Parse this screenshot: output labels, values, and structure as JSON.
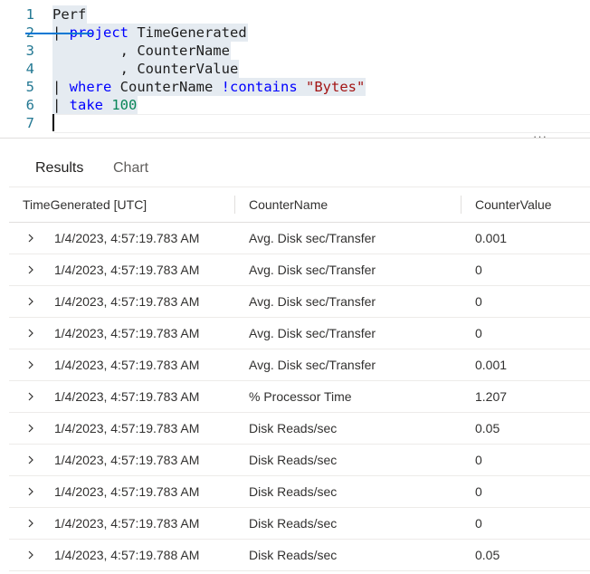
{
  "editor": {
    "lines": [
      {
        "num": "1",
        "tokens": [
          {
            "t": "Perf",
            "c": "plain"
          }
        ]
      },
      {
        "num": "2",
        "tokens": [
          {
            "t": "| ",
            "c": "bar"
          },
          {
            "t": "project",
            "c": "kw"
          },
          {
            "t": " TimeGenerated",
            "c": "plain"
          }
        ]
      },
      {
        "num": "3",
        "tokens": [
          {
            "t": "        , CounterName",
            "c": "plain"
          }
        ]
      },
      {
        "num": "4",
        "tokens": [
          {
            "t": "        , CounterValue",
            "c": "plain"
          }
        ]
      },
      {
        "num": "5",
        "tokens": [
          {
            "t": "| ",
            "c": "bar"
          },
          {
            "t": "where",
            "c": "kw"
          },
          {
            "t": " CounterName ",
            "c": "plain"
          },
          {
            "t": "!contains",
            "c": "kw"
          },
          {
            "t": " ",
            "c": "plain"
          },
          {
            "t": "\"Bytes\"",
            "c": "str"
          }
        ]
      },
      {
        "num": "6",
        "tokens": [
          {
            "t": "| ",
            "c": "bar"
          },
          {
            "t": "take",
            "c": "kw"
          },
          {
            "t": " ",
            "c": "plain"
          },
          {
            "t": "100",
            "c": "num"
          }
        ]
      },
      {
        "num": "7",
        "tokens": []
      }
    ],
    "more_label": "···"
  },
  "tabs": {
    "results": "Results",
    "chart": "Chart"
  },
  "table": {
    "columns": [
      "TimeGenerated [UTC]",
      "CounterName",
      "CounterValue"
    ],
    "rows": [
      [
        "1/4/2023, 4:57:19.783 AM",
        "Avg. Disk sec/Transfer",
        "0.001"
      ],
      [
        "1/4/2023, 4:57:19.783 AM",
        "Avg. Disk sec/Transfer",
        "0"
      ],
      [
        "1/4/2023, 4:57:19.783 AM",
        "Avg. Disk sec/Transfer",
        "0"
      ],
      [
        "1/4/2023, 4:57:19.783 AM",
        "Avg. Disk sec/Transfer",
        "0"
      ],
      [
        "1/4/2023, 4:57:19.783 AM",
        "Avg. Disk sec/Transfer",
        "0.001"
      ],
      [
        "1/4/2023, 4:57:19.783 AM",
        "% Processor Time",
        "1.207"
      ],
      [
        "1/4/2023, 4:57:19.783 AM",
        "Disk Reads/sec",
        "0.05"
      ],
      [
        "1/4/2023, 4:57:19.783 AM",
        "Disk Reads/sec",
        "0"
      ],
      [
        "1/4/2023, 4:57:19.783 AM",
        "Disk Reads/sec",
        "0"
      ],
      [
        "1/4/2023, 4:57:19.783 AM",
        "Disk Reads/sec",
        "0"
      ],
      [
        "1/4/2023, 4:57:19.788 AM",
        "Disk Reads/sec",
        "0.05"
      ]
    ]
  },
  "colors": {
    "keyword": "#0000ff",
    "number": "#098658",
    "string": "#a31515",
    "accent": "#0078d4"
  }
}
